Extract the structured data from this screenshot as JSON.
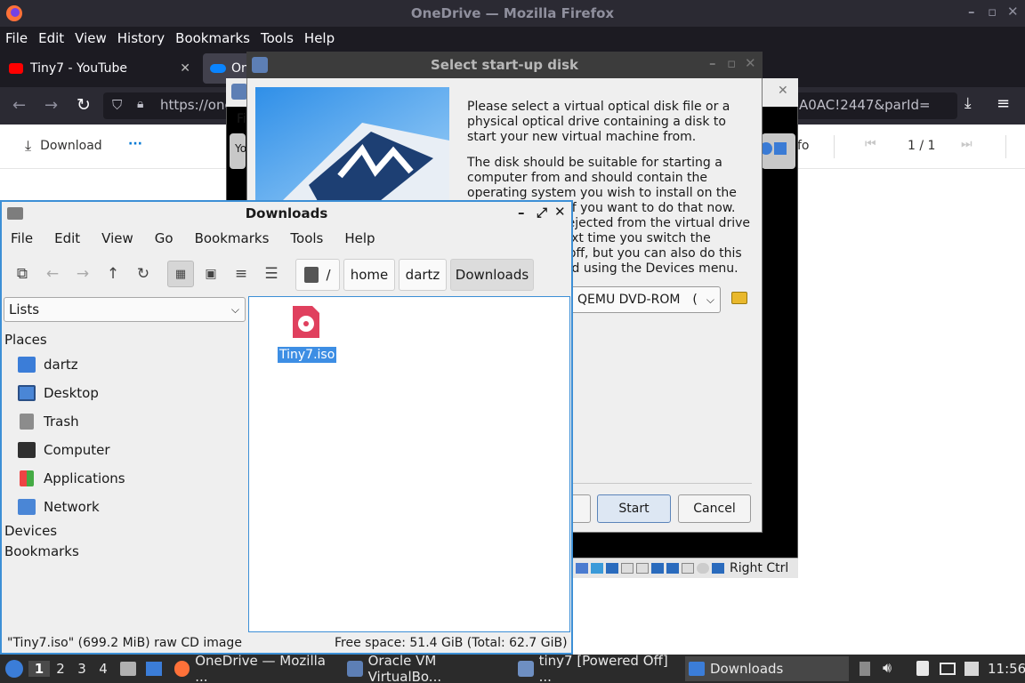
{
  "firefox": {
    "title": "OneDrive — Mozilla Firefox",
    "menu": [
      "File",
      "Edit",
      "View",
      "History",
      "Bookmarks",
      "Tools",
      "Help"
    ],
    "tabs": [
      {
        "label": "Tiny7 - YouTube"
      },
      {
        "label": "On"
      }
    ],
    "url_left": "https://one",
    "url_right": "A0AC!2447&parId=",
    "onedrive": {
      "download_label": "Download",
      "more_label": "···",
      "page_counter": "1 / 1",
      "info_fragment": "fo"
    }
  },
  "vbox_dark": {
    "left_fragment": "Fi",
    "left_fragment_2": "Yo",
    "host_key": "Right Ctrl"
  },
  "dialog": {
    "title": "Select start-up disk",
    "paragraph1": "Please select a virtual optical disk file or a physical optical drive containing a disk to start your new virtual machine from.",
    "paragraph2": "The disk should be suitable for starting a computer from and should contain the operating system you wish to install on the virtual machine if you want to do that now. The disk will be ejected from the virtual drive automatically next time you switch the virtual machine off, but you can also do this yourself if needed using the Devices menu.",
    "drive_value": "QEMU DVD-ROM",
    "drive_suffix": "(",
    "start_label": "Start",
    "cancel_label": "Cancel"
  },
  "file_manager": {
    "title": "Downloads",
    "menu": [
      "File",
      "Edit",
      "View",
      "Go",
      "Bookmarks",
      "Tools",
      "Help"
    ],
    "breadcrumb": [
      "/",
      "home",
      "dartz",
      "Downloads"
    ],
    "side_view": "Lists",
    "places_heading": "Places",
    "places": [
      {
        "label": "dartz",
        "icon": "home-folder-icon"
      },
      {
        "label": "Desktop",
        "icon": "desktop-icon"
      },
      {
        "label": "Trash",
        "icon": "trash-icon"
      },
      {
        "label": "Computer",
        "icon": "computer-icon"
      },
      {
        "label": "Applications",
        "icon": "applications-icon"
      },
      {
        "label": "Network",
        "icon": "network-icon"
      }
    ],
    "devices_heading": "Devices",
    "bookmarks_heading": "Bookmarks",
    "files": [
      {
        "name": "Tiny7.iso"
      }
    ],
    "status_left": "\"Tiny7.iso\" (699.2 MiB) raw CD image",
    "status_right": "Free space: 51.4 GiB (Total: 62.7 GiB)"
  },
  "taskbar": {
    "workspaces": [
      "1",
      "2",
      "3",
      "4"
    ],
    "tasks": [
      {
        "label": "OneDrive — Mozilla ..."
      },
      {
        "label": "Oracle VM VirtualBo..."
      },
      {
        "label": "tiny7 [Powered Off] ..."
      },
      {
        "label": "Downloads"
      }
    ],
    "clock": "11:56"
  },
  "colors": {
    "accent": "#3c8fd6",
    "selection": "#3d8ee4",
    "iso_icon": "#e0405e"
  }
}
